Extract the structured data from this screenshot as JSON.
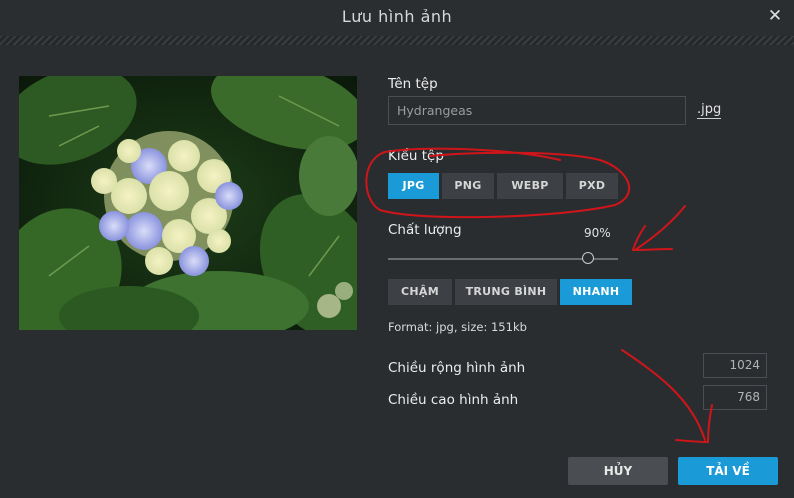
{
  "dialog": {
    "title": "Lưu hình ảnh"
  },
  "file": {
    "name_label": "Tên tệp",
    "name_value": "Hydrangeas",
    "extension": ".jpg"
  },
  "file_type": {
    "label": "Kiểu tệp",
    "options": [
      "JPG",
      "PNG",
      "WEBP",
      "PXD"
    ],
    "selected": "JPG"
  },
  "quality": {
    "label": "Chất lượng",
    "value_text": "90%",
    "value": 0.9
  },
  "speed": {
    "options": [
      "CHẬM",
      "TRUNG BÌNH",
      "NHANH"
    ],
    "selected": "NHANH"
  },
  "info": {
    "format_text": "Format: jpg, size: 151kb"
  },
  "dimensions": {
    "width_label": "Chiều rộng hình ảnh",
    "width_value": "1024",
    "height_label": "Chiều cao hình ảnh",
    "height_value": "768"
  },
  "actions": {
    "cancel": "HỦY",
    "download": "TẢI VỀ"
  },
  "colors": {
    "accent": "#1a9ad6",
    "annotation": "#d0151a",
    "background": "#2a2d30"
  },
  "icons": {
    "close": "close-icon"
  }
}
